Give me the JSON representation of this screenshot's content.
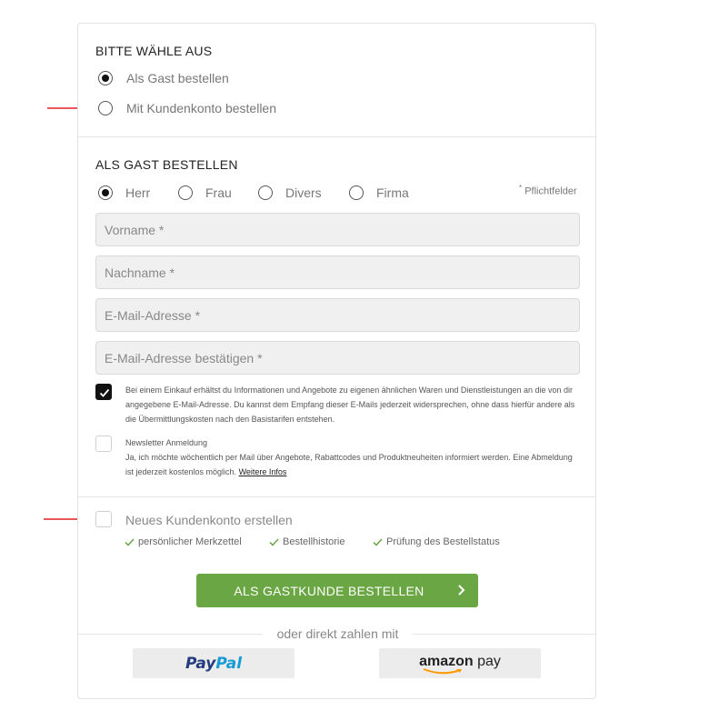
{
  "choose_section": {
    "title": "BITTE WÄHLE AUS",
    "options": [
      {
        "label": "Als Gast bestellen",
        "selected": true
      },
      {
        "label": "Mit Kundenkonto bestellen",
        "selected": false
      }
    ]
  },
  "guest_section": {
    "title": "ALS GAST BESTELLEN",
    "required_note": "Pflichtfelder",
    "required_marker": "*",
    "salutations": [
      {
        "label": "Herr",
        "selected": true
      },
      {
        "label": "Frau",
        "selected": false
      },
      {
        "label": "Divers",
        "selected": false
      },
      {
        "label": "Firma",
        "selected": false
      }
    ],
    "fields": {
      "firstname_placeholder": "Vorname *",
      "lastname_placeholder": "Nachname *",
      "email_placeholder": "E-Mail-Adresse *",
      "email_confirm_placeholder": "E-Mail-Adresse bestätigen *"
    },
    "consent": {
      "checked": true,
      "text": "Bei einem Einkauf erhältst du Informationen und Angebote zu eigenen ähnlichen Waren und Dienstleistungen an die von dir angegebene E-Mail-Adresse. Du kannst dem Empfang dieser E-Mails jederzeit widersprechen, ohne dass hierfür andere als die Übermittlungskosten nach den Basistarifen entstehen."
    },
    "newsletter": {
      "checked": false,
      "title": "Newsletter Anmeldung",
      "text": "Ja, ich möchte wöchentlich per Mail über Angebote, Rabattcodes und Produktneuheiten informiert werden. Eine Abmeldung ist jederzeit kostenlos möglich.",
      "link": "Weitere Infos"
    }
  },
  "account_section": {
    "checked": false,
    "label": "Neues Kundenkonto erstellen",
    "benefits": [
      "persönlicher Merkzettel",
      "Bestellhistorie",
      "Prüfung des Bestellstatus"
    ]
  },
  "submit": {
    "label": "ALS GASTKUNDE BESTELLEN"
  },
  "direct_pay": {
    "label": "oder direkt zahlen mit",
    "paypal": {
      "pay": "Pay",
      "pal": "Pal"
    },
    "amazon": {
      "brand": "amazon",
      "pay": "pay"
    }
  },
  "colors": {
    "accent": "#6aa644",
    "annotation_arrow": "#e02020",
    "paypal_dark": "#253b80",
    "paypal_light": "#179bd7",
    "amazon_orange": "#ff9900"
  }
}
